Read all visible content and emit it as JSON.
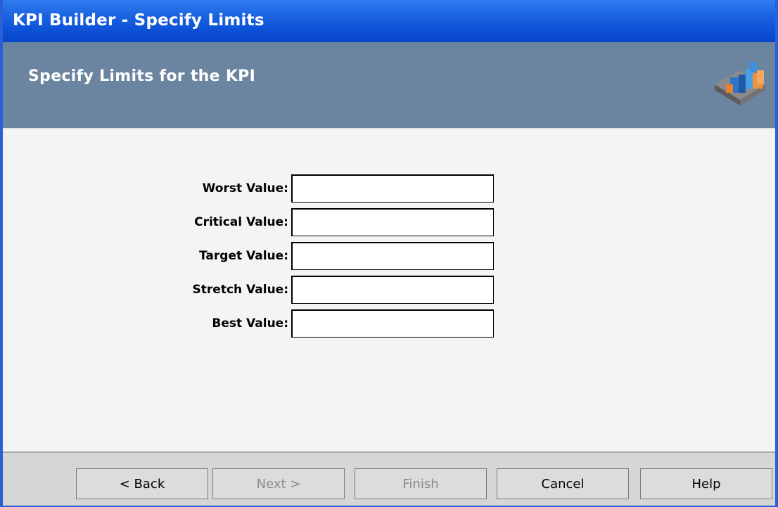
{
  "window": {
    "title": "KPI Builder - Specify Limits"
  },
  "header": {
    "title": "Specify Limits for the KPI",
    "icon": "kpi-chart-icon"
  },
  "form": {
    "fields": [
      {
        "label": "Worst Value:",
        "value": ""
      },
      {
        "label": "Critical Value:",
        "value": ""
      },
      {
        "label": "Target Value:",
        "value": ""
      },
      {
        "label": "Stretch Value:",
        "value": ""
      },
      {
        "label": "Best Value:",
        "value": ""
      }
    ]
  },
  "buttons": {
    "back": "< Back",
    "next": "Next >",
    "finish": "Finish",
    "cancel": "Cancel",
    "help": "Help"
  },
  "colors": {
    "titlebar": "#0b4fd6",
    "header": "#6b85a0",
    "content": "#f4f4f4",
    "footer": "#d6d6d6"
  }
}
